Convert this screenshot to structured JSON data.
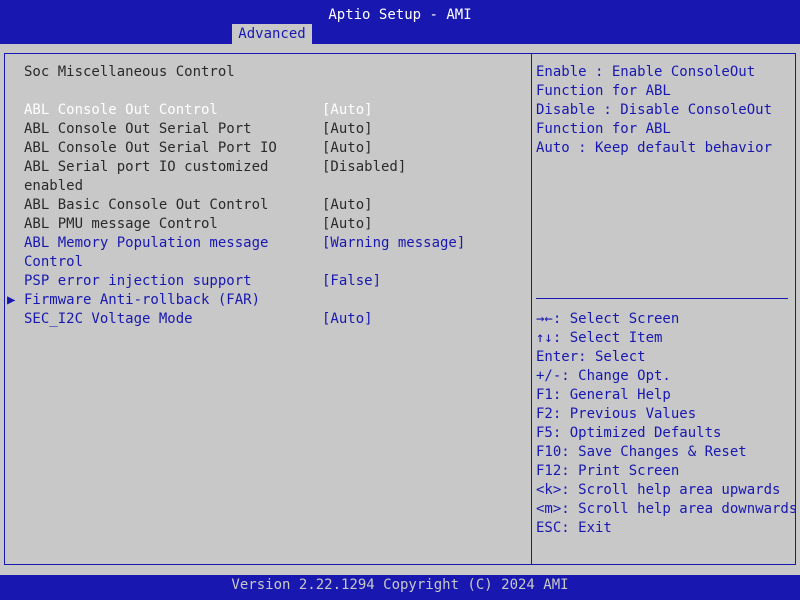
{
  "header": {
    "title": "Aptio Setup - AMI",
    "tab_label": "Advanced"
  },
  "page": {
    "heading": "Soc Miscellaneous Control"
  },
  "settings": [
    {
      "label": "ABL Console Out Control",
      "value": "[Auto]"
    },
    {
      "label": "ABL Console Out Serial Port",
      "value": "[Auto]"
    },
    {
      "label": "ABL Console Out Serial Port IO",
      "value": "[Auto]"
    },
    {
      "label": "ABL Serial port IO customized",
      "label2": "enabled",
      "value": "[Disabled]"
    },
    {
      "label": "ABL Basic Console Out Control",
      "value": "[Auto]"
    },
    {
      "label": "ABL PMU message Control",
      "value": "[Auto]"
    },
    {
      "label": "ABL Memory Population message",
      "label2": "Control",
      "value": "[Warning message]"
    },
    {
      "label": "PSP error injection support",
      "value": "[False]"
    },
    {
      "label": "Firmware Anti-rollback (FAR)",
      "value": ""
    },
    {
      "label": "SEC_I2C Voltage Mode",
      "value": "[Auto]"
    }
  ],
  "help": {
    "lines": [
      "Enable : Enable ConsoleOut",
      "Function for ABL",
      "Disable : Disable ConsoleOut",
      "Function for ABL",
      "Auto : Keep default behavior"
    ]
  },
  "keys": [
    "→←: Select Screen",
    "↑↓: Select Item",
    "Enter: Select",
    "+/-: Change Opt.",
    "F1: General Help",
    "F2: Previous Values",
    "F5: Optimized Defaults",
    "F10: Save Changes & Reset",
    "F12: Print Screen",
    "<k>: Scroll help area upwards",
    "<m>: Scroll help area downwards",
    "ESC: Exit"
  ],
  "footer": {
    "version": "Version 2.22.1294 Copyright (C) 2024 AMI"
  },
  "colors": {
    "frame_blue": "#1818b0",
    "panel_gray": "#c8c8c8",
    "selected_white": "#ffffff",
    "text_dark": "#2a2a2a"
  }
}
